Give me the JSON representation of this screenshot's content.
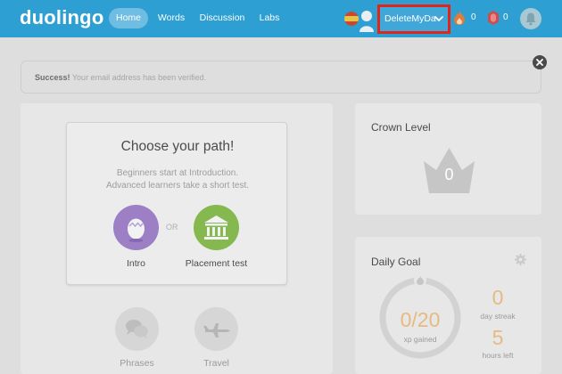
{
  "header": {
    "logo": "duolingo",
    "nav": [
      {
        "label": "Home",
        "active": true
      },
      {
        "label": "Words"
      },
      {
        "label": "Discussion"
      },
      {
        "label": "Labs"
      }
    ],
    "username": "DeleteMyDa",
    "streak_count": "0",
    "gems_count": "0",
    "icons": {
      "flag": "spain-flag-icon",
      "avatar": "avatar-icon",
      "dropdown": "chevron-down-icon",
      "streak": "flame-icon",
      "gems": "lingot-icon",
      "notifications": "bell-icon"
    }
  },
  "banner": {
    "strong": "Success!",
    "message": "Your email address has been verified."
  },
  "path": {
    "title": "Choose your path!",
    "subtitle_line1": "Beginners start at Introduction.",
    "subtitle_line2": "Advanced learners take a short test.",
    "or_label": "OR",
    "options": [
      {
        "label": "Intro",
        "icon": "egg-icon",
        "color": "#9c7fc4"
      },
      {
        "label": "Placement test",
        "icon": "building-icon",
        "color": "#86b850"
      }
    ]
  },
  "skills": [
    {
      "label": "Phrases",
      "icon": "speech-bubbles-icon"
    },
    {
      "label": "Travel",
      "icon": "airplane-icon"
    }
  ],
  "crown": {
    "title": "Crown Level",
    "value": "0"
  },
  "daily_goal": {
    "title": "Daily Goal",
    "progress": "0/20",
    "progress_label": "xp gained",
    "streak_value": "0",
    "streak_label": "day streak",
    "hours_value": "5",
    "hours_label": "hours left",
    "progress_fraction": 0
  },
  "colors": {
    "brand_blue": "#2e9fd2",
    "highlight_red": "#e0251b",
    "gold": "#e6ba82"
  }
}
